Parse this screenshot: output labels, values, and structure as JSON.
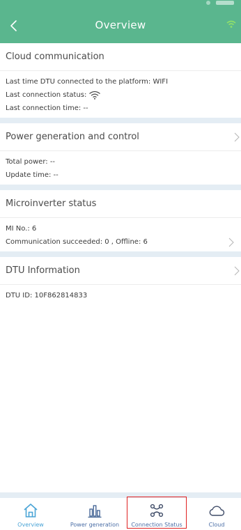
{
  "header": {
    "title": "Overview"
  },
  "sections": [
    {
      "title": "Cloud communication",
      "lines": [
        "Last time DTU connected to the platform: WIFI",
        "Last connection status: ",
        "Last connection time: --"
      ]
    },
    {
      "title": "Power generation and control",
      "lines": [
        "Total power: --",
        "Update time: --"
      ]
    },
    {
      "title": "Microinverter status",
      "lines": [
        "MI No.: 6",
        "Communication succeeded: 0 , Offline: 6"
      ]
    },
    {
      "title": "DTU Information",
      "lines": [
        "DTU ID: 10F862814833"
      ]
    }
  ],
  "tabs": [
    {
      "label": "Overview",
      "icon": "home-icon",
      "active": true
    },
    {
      "label": "Power generation",
      "icon": "bar-chart-icon",
      "active": false
    },
    {
      "label": "Connection Status",
      "icon": "network-icon",
      "active": false,
      "highlighted": true
    },
    {
      "label": "Cloud",
      "icon": "cloud-icon",
      "active": false
    }
  ],
  "colors": {
    "header": "#5ab68e",
    "separator": "#e4edf4",
    "tab_label": "#4b6ea6",
    "tab_active": "#4aa4d6",
    "highlight": "#e02020"
  }
}
